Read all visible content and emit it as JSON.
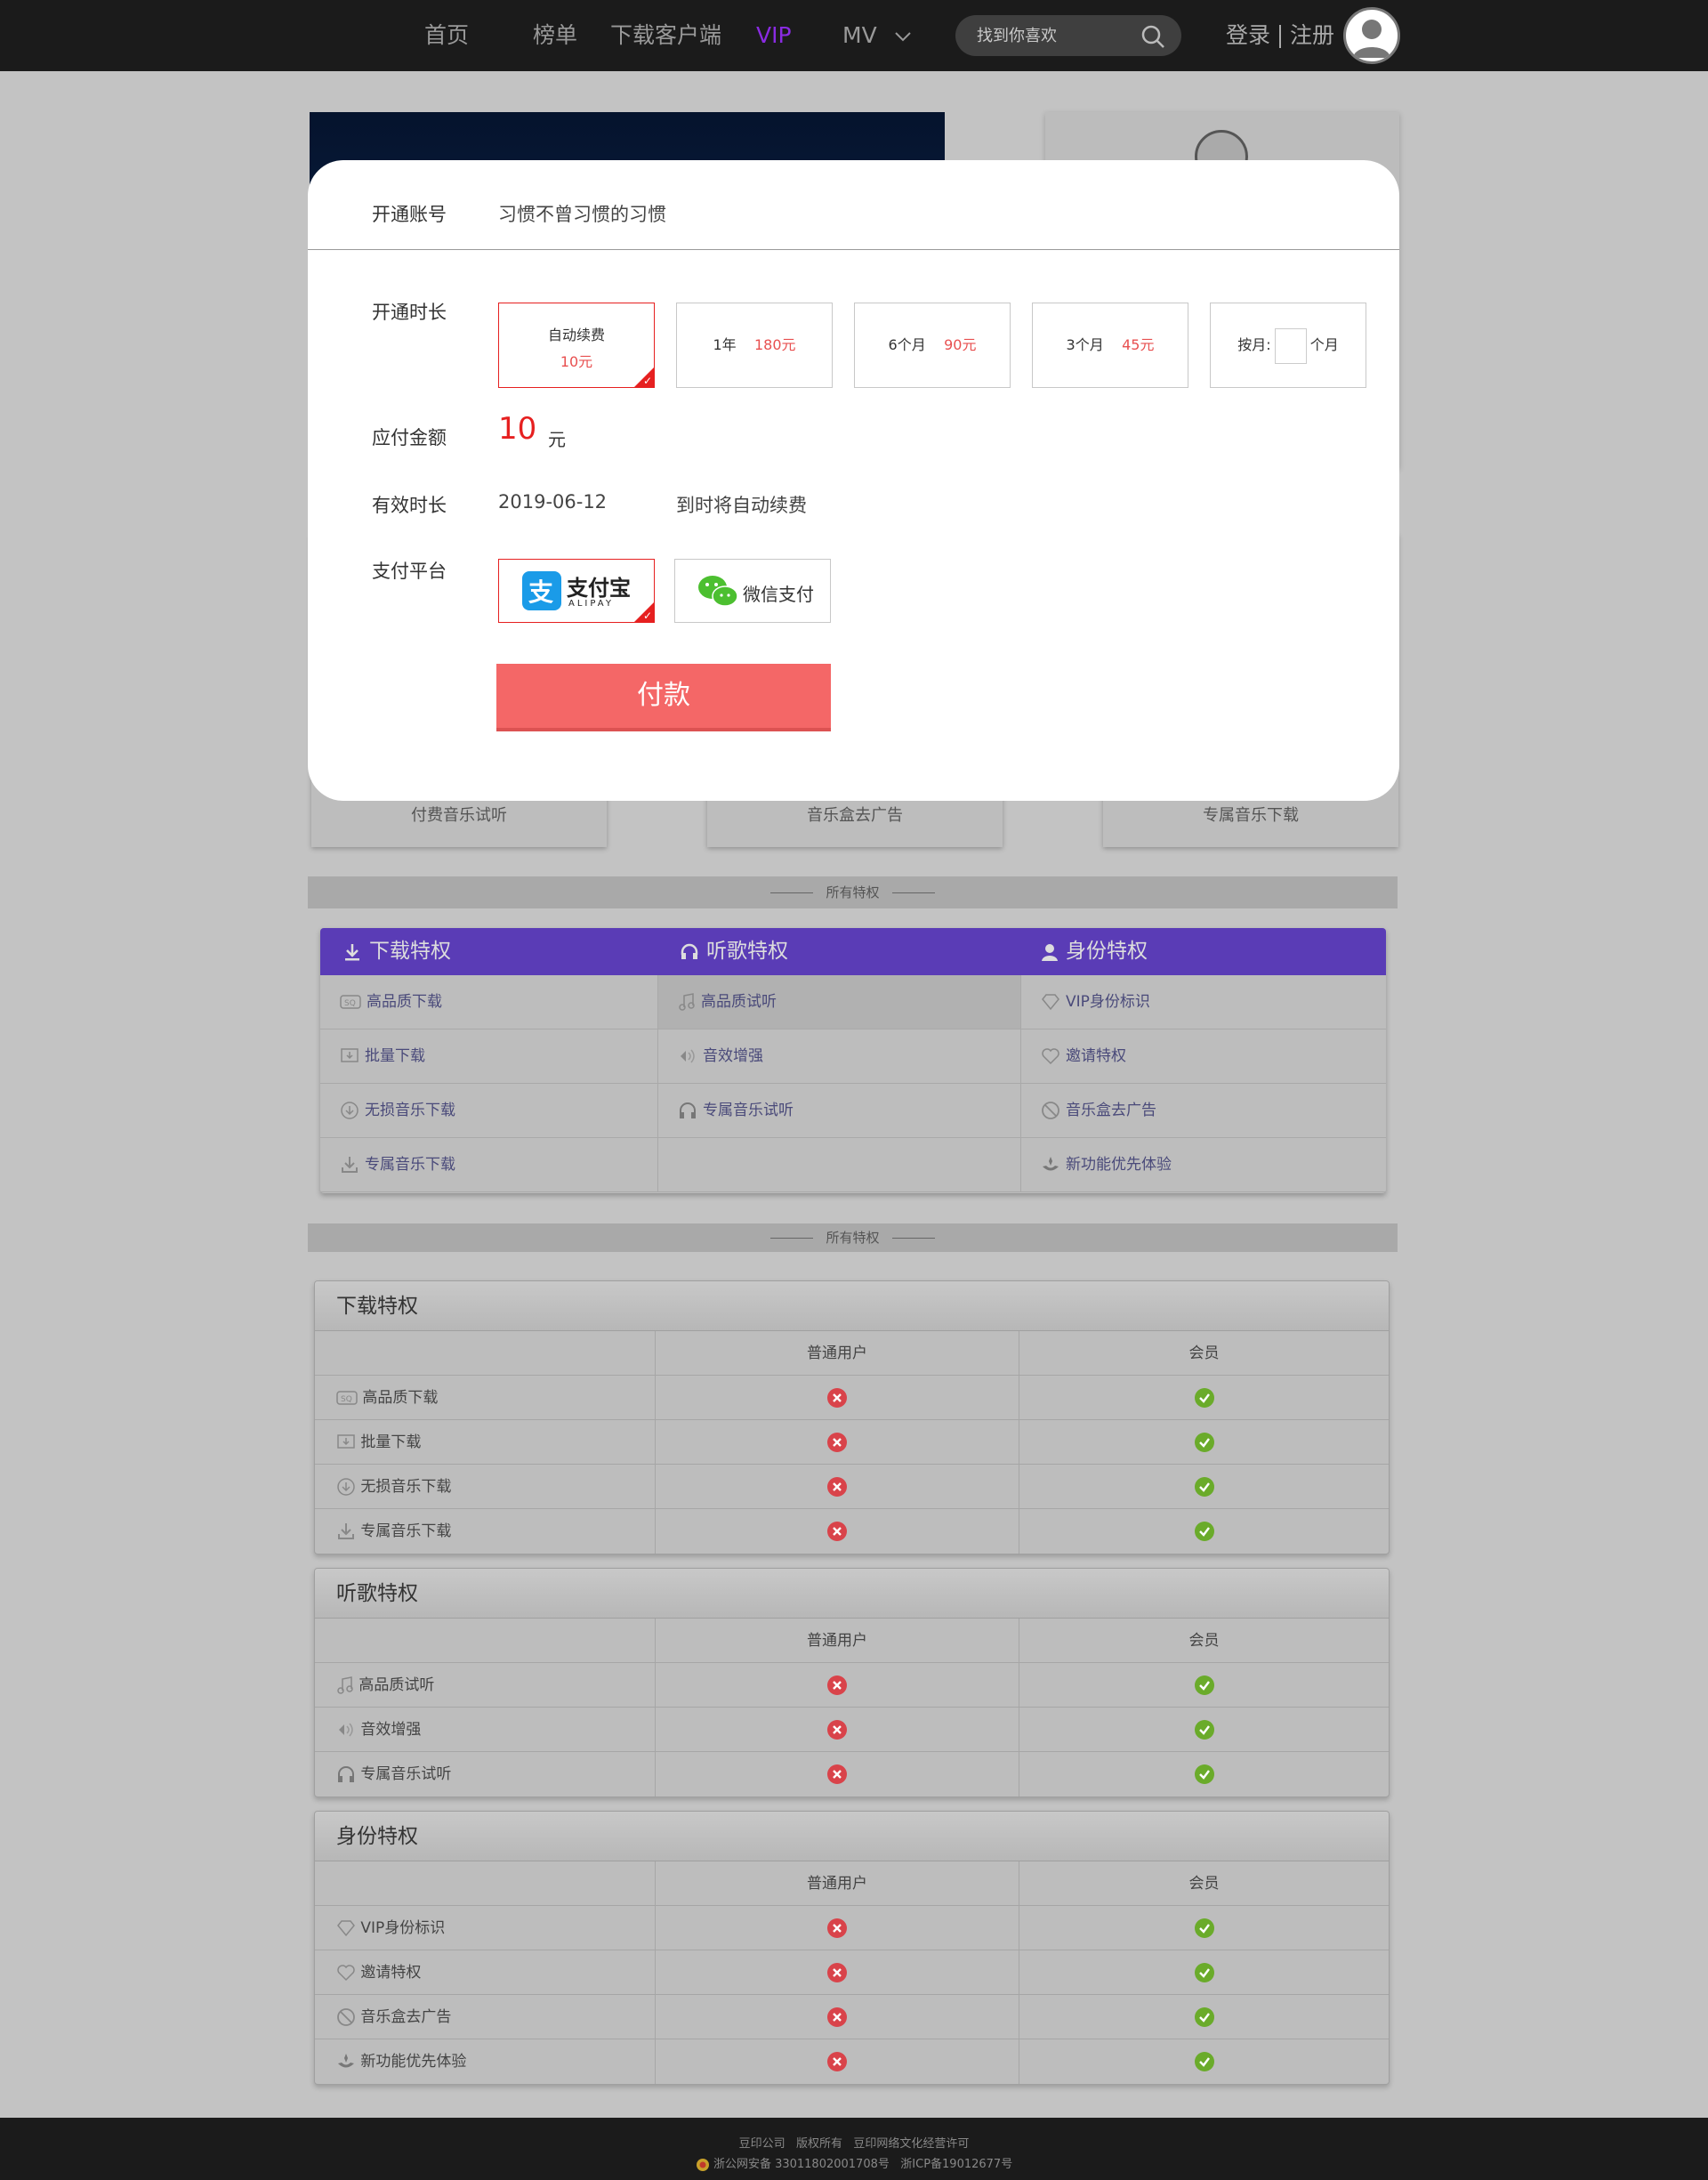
{
  "nav": {
    "items": [
      "首页",
      "榜单",
      "下载客户端",
      "VIP",
      "MV"
    ],
    "search_placeholder": "找到你喜欢",
    "login": "登录",
    "register": "注册"
  },
  "colors": {
    "vip": "#8a2be2",
    "price": "#e85050",
    "pay_button": "#f46767",
    "panel_head": "#5a3cb6",
    "yes": "#6aab2a",
    "no": "#d9434a"
  },
  "background": {
    "features": [
      "付费音乐试听",
      "音乐盒去广告",
      "专属音乐下载"
    ]
  },
  "band": {
    "label1": "所有特权",
    "label2": "所有特权"
  },
  "privilege_panel": {
    "tabs": [
      "下载特权",
      "听歌特权",
      "身份特权"
    ],
    "columns": [
      [
        "高品质下载",
        "批量下载",
        "无损音乐下载",
        "专属音乐下载"
      ],
      [
        "高品质试听",
        "音效增强",
        "专属音乐试听",
        ""
      ],
      [
        "VIP身份标识",
        "邀请特权",
        "音乐盒去广告",
        "新功能优先体验"
      ]
    ]
  },
  "tables": [
    {
      "title": "下载特权",
      "col_normal": "普通用户",
      "col_member": "会员",
      "rows": [
        "高品质下载",
        "批量下载",
        "无损音乐下载",
        "专属音乐下载"
      ]
    },
    {
      "title": "听歌特权",
      "col_normal": "普通用户",
      "col_member": "会员",
      "rows": [
        "高品质试听",
        "音效增强",
        "专属音乐试听"
      ]
    },
    {
      "title": "身份特权",
      "col_normal": "普通用户",
      "col_member": "会员",
      "rows": [
        "VIP身份标识",
        "邀请特权",
        "音乐盒去广告",
        "新功能优先体验"
      ]
    }
  ],
  "modal": {
    "account_label": "开通账号",
    "account_value": "习惯不曾习惯的习惯",
    "duration_label": "开通时长",
    "options": [
      {
        "name": "自动续费",
        "price": "10元"
      },
      {
        "name": "1年",
        "price": "180元"
      },
      {
        "name": "6个月",
        "price": "90元"
      },
      {
        "name": "3个月",
        "price": "45元"
      },
      {
        "name": "按月:",
        "suffix": "个月"
      }
    ],
    "amount_label": "应付金额",
    "amount_value": "10",
    "amount_unit": "元",
    "valid_label": "有效时长",
    "valid_date": "2019-06-12",
    "valid_note": "到时将自动续费",
    "platform_label": "支付平台",
    "alipay_cn": "支付宝",
    "alipay_en": "ALIPAY",
    "wechat": "微信支付",
    "pay_button": "付款"
  },
  "footer": {
    "company": "豆印公司",
    "rights": "版权所有",
    "license": "豆印网络文化经营许可",
    "police": "浙公网安备 33011802001708号",
    "icp": "浙ICP备19012677号"
  }
}
